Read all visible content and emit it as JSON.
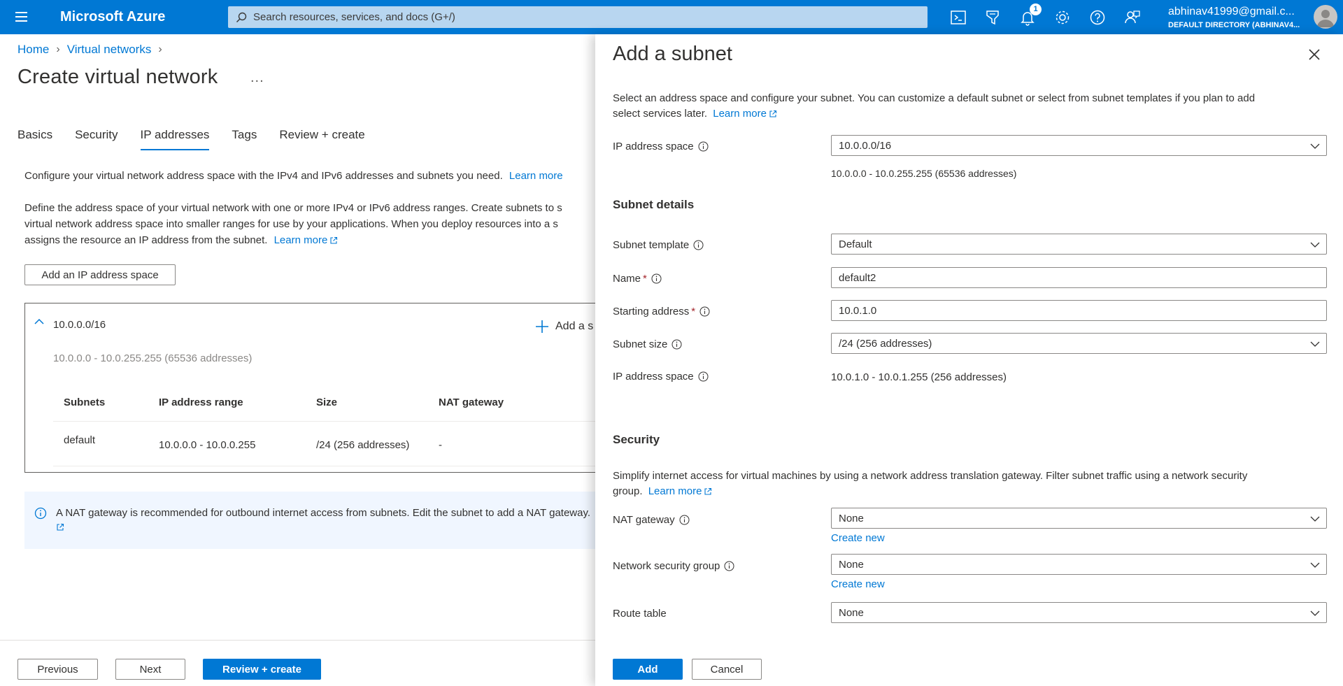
{
  "topbar": {
    "menu_icon": "hamburger-icon",
    "brand": "Microsoft Azure",
    "search_placeholder": "Search resources, services, and docs (G+/)",
    "notification_count": "1",
    "account_email": "abhinav41999@gmail.c...",
    "account_directory": "DEFAULT DIRECTORY (ABHINAV4...",
    "icons": [
      "cloud-shell-icon",
      "directory-filter-icon",
      "bell-icon",
      "gear-icon",
      "help-icon",
      "feedback-icon"
    ],
    "accent": "#0078d4"
  },
  "breadcrumb": [
    "Home",
    "Virtual networks"
  ],
  "page": {
    "title": "Create virtual network",
    "more": "...",
    "tabs": [
      "Basics",
      "Security",
      "IP addresses",
      "Tags",
      "Review + create"
    ],
    "active_tab": "IP addresses",
    "intro": "Configure your virtual network address space with the IPv4 and IPv6 addresses and subnets you need.",
    "intro_link": "Learn more",
    "define_line1": "Define the address space of your virtual network with one or more IPv4 or IPv6 address ranges. Create subnets to s",
    "define_line2": "virtual network address space into smaller ranges for use by your applications. When you deploy resources into a s",
    "define_line3": "assigns the resource an IP address from the subnet.",
    "define_link": "Learn more",
    "add_space_button": "Add an IP address space",
    "address_space": {
      "cidr": "10.0.0.0/16",
      "range": "10.0.0.0 - 10.0.255.255 (65536 addresses)",
      "add_subnet": "Add a s",
      "columns": [
        "Subnets",
        "IP address range",
        "Size",
        "NAT gateway"
      ],
      "rows": [
        {
          "name": "default",
          "range": "10.0.0.0 - 10.0.0.255",
          "size": "/24 (256 addresses)",
          "nat": "-"
        }
      ]
    },
    "info_banner": "A NAT gateway is recommended for outbound internet access from subnets. Edit the subnet to add a NAT gateway.",
    "footer": {
      "previous": "Previous",
      "next": "Next",
      "review": "Review + create"
    }
  },
  "panel": {
    "title": "Add a subnet",
    "desc_line1": "Select an address space and configure your subnet. You can customize a default subnet or select from subnet templates if you plan to add",
    "desc_line2": "select services later.",
    "desc_link": "Learn more",
    "ip_space_label": "IP address space",
    "ip_space_value": "10.0.0.0/16",
    "ip_space_note": "10.0.0.0 - 10.0.255.255 (65536 addresses)",
    "subnet_details_heading": "Subnet details",
    "template_label": "Subnet template",
    "template_value": "Default",
    "name_label": "Name",
    "name_value": "default2",
    "start_label": "Starting address",
    "start_value": "10.0.1.0",
    "size_label": "Subnet size",
    "size_value": "/24 (256 addresses)",
    "subnet_space_label": "IP address space",
    "subnet_space_value": "10.0.1.0 - 10.0.1.255 (256 addresses)",
    "security_heading": "Security",
    "sec_line1": "Simplify internet access for virtual machines by using a network address translation gateway. Filter subnet traffic using a network security",
    "sec_line2": "group.",
    "sec_link": "Learn more",
    "nat_label": "NAT gateway",
    "nat_value": "None",
    "nsg_label": "Network security group",
    "nsg_value": "None",
    "route_label": "Route table",
    "route_value": "None",
    "create_new": "Create new",
    "required_mark": "*",
    "add_button": "Add",
    "cancel_button": "Cancel"
  }
}
